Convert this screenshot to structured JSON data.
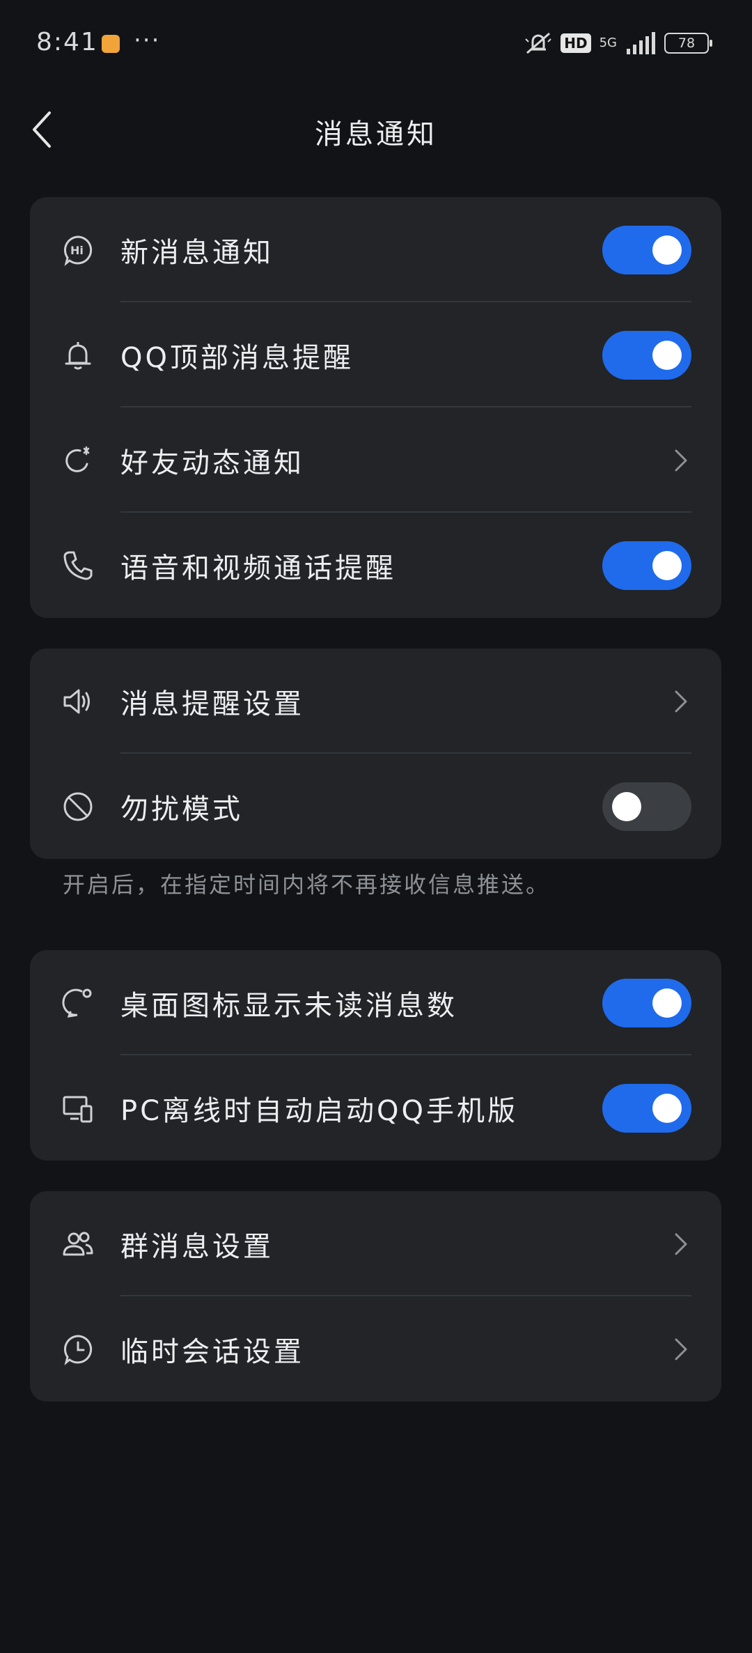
{
  "status_bar": {
    "time": "8:41",
    "more": "···",
    "hd": "HD",
    "network": "5G",
    "battery": "78"
  },
  "header": {
    "title": "消息通知"
  },
  "colors": {
    "accent": "#1f6bec",
    "card": "#222427",
    "background": "#111316"
  },
  "group1": [
    {
      "label": "新消息通知",
      "icon": "hi-bubble-icon",
      "control": "toggle",
      "on": true
    },
    {
      "label": "QQ顶部消息提醒",
      "icon": "bell-icon",
      "control": "toggle",
      "on": true
    },
    {
      "label": "好友动态通知",
      "icon": "refresh-star-icon",
      "control": "chevron"
    },
    {
      "label": "语音和视频通话提醒",
      "icon": "phone-icon",
      "control": "toggle",
      "on": true
    }
  ],
  "group2": [
    {
      "label": "消息提醒设置",
      "icon": "speaker-icon",
      "control": "chevron"
    },
    {
      "label": "勿扰模式",
      "icon": "prohibited-icon",
      "control": "toggle",
      "on": false
    }
  ],
  "dnd_hint": "开启后，在指定时间内将不再接收信息推送。",
  "group3": [
    {
      "label": "桌面图标显示未读消息数",
      "icon": "badge-bubble-icon",
      "control": "toggle",
      "on": true
    },
    {
      "label": "PC离线时自动启动QQ手机版",
      "icon": "devices-icon",
      "control": "toggle",
      "on": true
    }
  ],
  "group4": [
    {
      "label": "群消息设置",
      "icon": "group-icon",
      "control": "chevron"
    },
    {
      "label": "临时会话设置",
      "icon": "clock-bubble-icon",
      "control": "chevron"
    }
  ]
}
